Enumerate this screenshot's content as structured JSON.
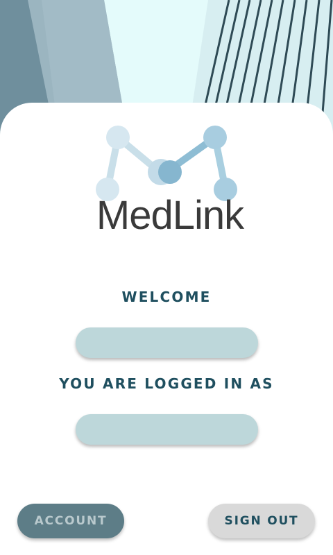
{
  "app": {
    "logo_text": "MedLink"
  },
  "main": {
    "welcome_label": "WELCOME",
    "welcome_value": "",
    "logged_in_label": "YOU ARE LOGGED IN AS",
    "logged_in_value": ""
  },
  "actions": {
    "account_label": "ACCOUNT",
    "signout_label": "SIGN OUT"
  },
  "colors": {
    "accent": "#1f4f5f",
    "field_bg": "#bdd7da",
    "account_button": "#5d7d87",
    "signout_button": "#d9d9d9"
  }
}
